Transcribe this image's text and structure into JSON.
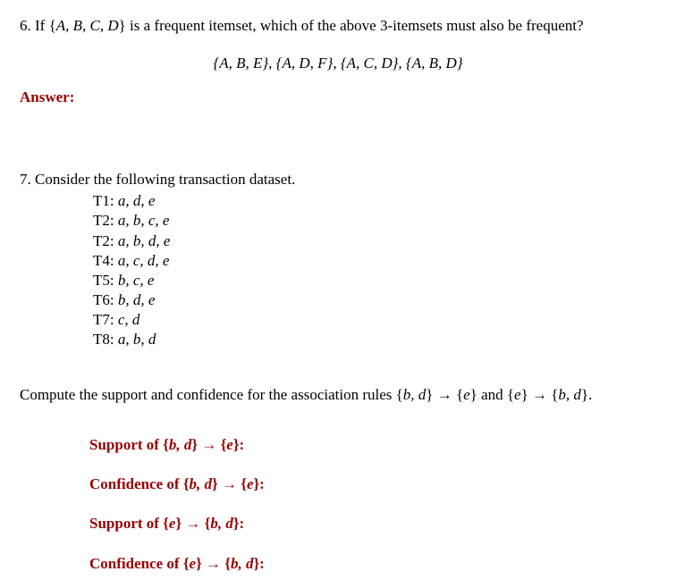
{
  "q6": {
    "text_pre": "6. If {",
    "set": "A, B, C, D",
    "text_mid": "} is a frequent itemset, which of the above 3-itemsets must also be frequent?",
    "candidates": "{A, B, E}, {A, D, F}, {A, C, D}, {A, B, D}",
    "answer_label": "Answer:"
  },
  "q7": {
    "intro": "7. Consider the following transaction dataset.",
    "transactions": [
      {
        "id": "T1:",
        "items": " a, d, e"
      },
      {
        "id": "T2:",
        "items": " a, b, c, e"
      },
      {
        "id": "T2:",
        "items": " a, b, d, e"
      },
      {
        "id": "T4:",
        "items": " a, c, d, e"
      },
      {
        "id": "T5:",
        "items": " b, c, e"
      },
      {
        "id": "T6:",
        "items": " b, d, e"
      },
      {
        "id": "T7:",
        "items": " c, d"
      },
      {
        "id": "T8:",
        "items": " a, b, d"
      }
    ],
    "compute_pre": "Compute the support and confidence for the association rules {",
    "compute_r1_lhs": "b, d",
    "compute_r1_mid": "} → {",
    "compute_r1_rhs": "e",
    "compute_between": "} and {",
    "compute_r2_lhs": "e",
    "compute_r2_mid": "} → {",
    "compute_r2_rhs": "b, d",
    "compute_end": "}.",
    "lines": {
      "s1_pre": "Support of {",
      "s1_lhs": "b, d",
      "s1_mid": "} → {",
      "s1_rhs": "e",
      "s1_end": "}:",
      "c1_pre": "Confidence of {",
      "c1_lhs": "b, d",
      "c1_mid": "} → {",
      "c1_rhs": "e",
      "c1_end": "}:",
      "s2_pre": "Support of {",
      "s2_lhs": "e",
      "s2_mid": "} → {",
      "s2_rhs": "b, d",
      "s2_end": "}:",
      "c2_pre": "Confidence of {",
      "c2_lhs": "e",
      "c2_mid": "} → {",
      "c2_rhs": "b, d",
      "c2_end": "}:"
    }
  }
}
